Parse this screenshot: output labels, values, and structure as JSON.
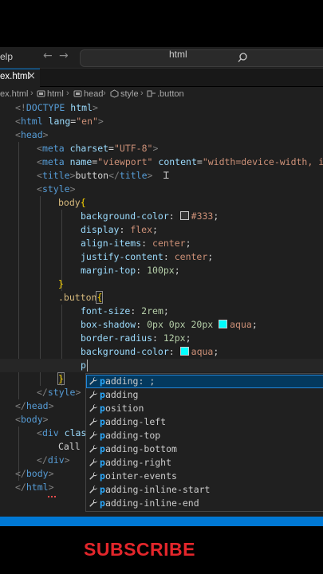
{
  "titlebar": {
    "menu_help": "elp",
    "nav_back": "←",
    "nav_forward": "→",
    "search_label": "html"
  },
  "tab": {
    "label": "ex.html",
    "close": "×"
  },
  "breadcrumb": {
    "file": "ex.html",
    "items": [
      "html",
      "head",
      "style",
      ".button"
    ],
    "separator": "›"
  },
  "code": {
    "l1": [
      "<!",
      "DOCTYPE",
      " ",
      "html",
      ">"
    ],
    "l2": [
      "<",
      "html",
      " ",
      "lang",
      "=",
      "\"en\"",
      ">"
    ],
    "l3": [
      "<",
      "head",
      ">"
    ],
    "l4": [
      "<",
      "meta",
      " ",
      "charset",
      "=",
      "\"UTF-8\"",
      ">"
    ],
    "l5": [
      "<",
      "meta",
      " ",
      "name",
      "=",
      "\"viewport\"",
      " ",
      "content",
      "=",
      "\"width=device-width, i"
    ],
    "l6": [
      "<",
      "title",
      ">",
      "button",
      "</",
      "title",
      ">"
    ],
    "l7": [
      "<",
      "style",
      ">"
    ],
    "l8": [
      "body",
      "{"
    ],
    "l9": [
      "background-color",
      ": ",
      "#333",
      ";"
    ],
    "l10": [
      "display",
      ": ",
      "flex",
      ";"
    ],
    "l11": [
      "align-items",
      ": ",
      "center",
      ";"
    ],
    "l12": [
      "justify-content",
      ": ",
      "center",
      ";"
    ],
    "l13": [
      "margin-top",
      ": ",
      "100px",
      ";"
    ],
    "l14": [
      "}"
    ],
    "l15": [
      ".button",
      "{"
    ],
    "l16": [
      "font-size",
      ": ",
      "2rem",
      ";"
    ],
    "l17": [
      "box-shadow",
      ": ",
      "0px 0px 20px ",
      "aqua",
      ";"
    ],
    "l18": [
      "border-radius",
      ": ",
      "12px",
      ";"
    ],
    "l19": [
      "background-color",
      ": ",
      "aqua",
      ";"
    ],
    "l20": [
      "p"
    ],
    "l21": [
      "}"
    ],
    "l22": [
      "</",
      "style",
      ">"
    ],
    "l23": [
      "</",
      "head",
      ">"
    ],
    "l24": [
      "<",
      "body",
      ">"
    ],
    "l25": [
      "<",
      "div",
      " ",
      "clas"
    ],
    "l26": [
      "Call"
    ],
    "l27": [
      "</",
      "div",
      ">"
    ],
    "l28": [
      "</",
      "body",
      ">"
    ],
    "l29": [
      "</",
      "html",
      ">"
    ]
  },
  "suggestions": [
    {
      "match": "p",
      "rest": "adding: ;"
    },
    {
      "match": "p",
      "rest": "adding"
    },
    {
      "match": "p",
      "rest": "osition"
    },
    {
      "match": "p",
      "rest": "adding-left"
    },
    {
      "match": "p",
      "rest": "adding-top"
    },
    {
      "match": "p",
      "rest": "adding-bottom"
    },
    {
      "match": "p",
      "rest": "adding-right"
    },
    {
      "match": "p",
      "rest": "ointer-events"
    },
    {
      "match": "p",
      "rest": "adding-inline-start"
    },
    {
      "match": "p",
      "rest": "adding-inline-end"
    }
  ],
  "overlay_text": "SUBSCRIBE",
  "colors": {
    "swatch_333": "#333333",
    "swatch_aqua": "#00ffff",
    "accent": "#0078d4",
    "subscribe": "#e3262b"
  }
}
